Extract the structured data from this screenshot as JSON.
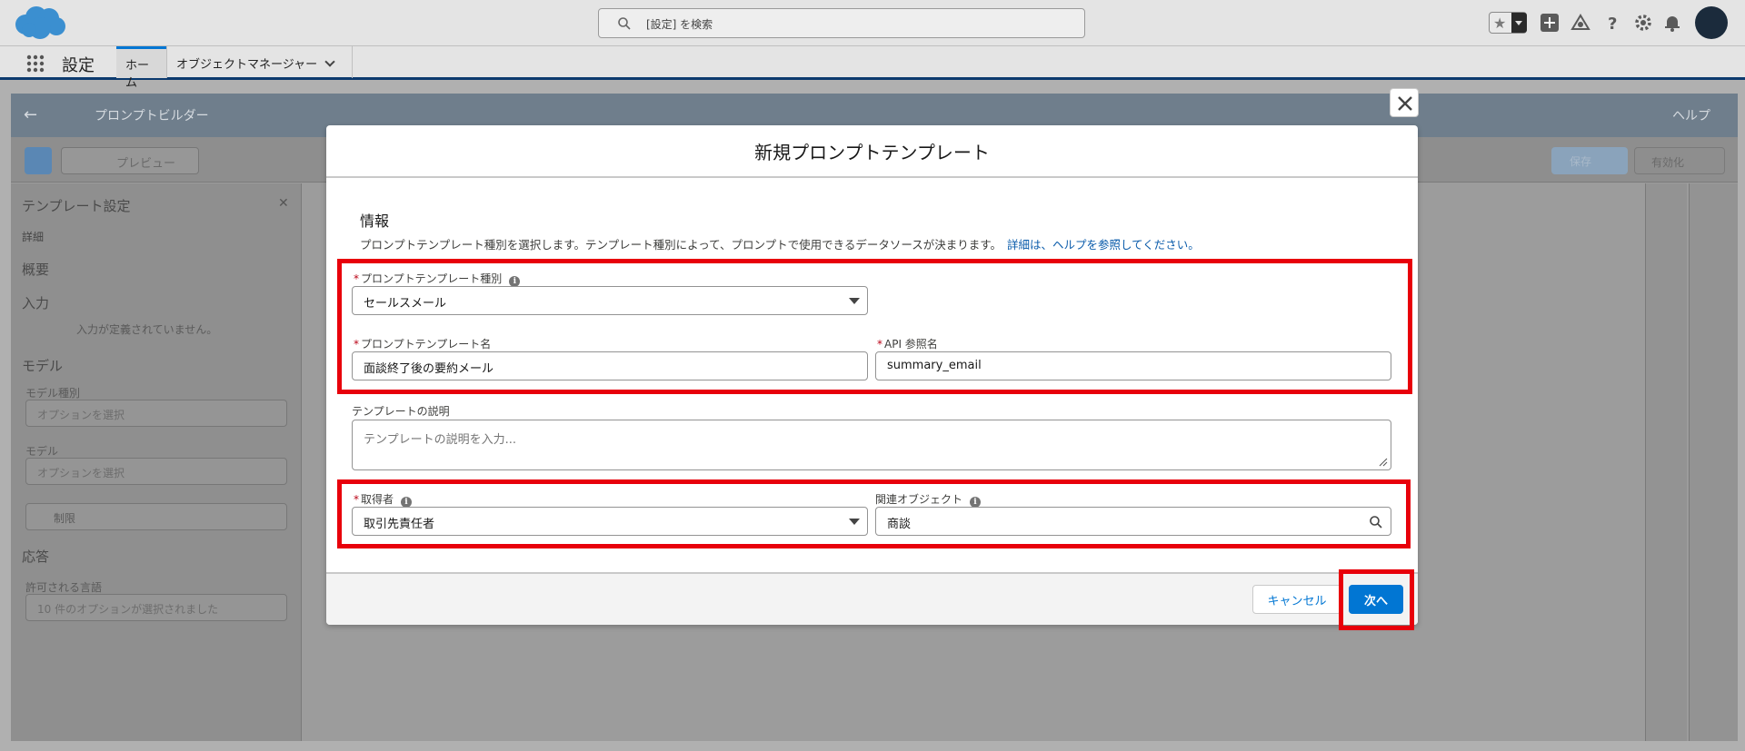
{
  "search": {
    "placeholder": "[設定] を検索"
  },
  "app": {
    "name": "設定"
  },
  "nav_tabs": [
    {
      "label": "ホーム"
    },
    {
      "label": "オブジェクトマネージャー"
    }
  ],
  "builder": {
    "title": "プロンプトビルダー",
    "help": "ヘルプ",
    "preview": "プレビュー",
    "save": "保存",
    "activate": "有効化",
    "left_panel": {
      "title": "テンプレート設定",
      "tab": "詳細",
      "sections": [
        "概要",
        "入力",
        "モデル",
        "応答"
      ],
      "no_inputs": "入力が定義されていません。",
      "model_type_label": "モデル種別",
      "model_label": "モデル",
      "select_placeholder": "オプションを選択",
      "limits": "制限",
      "allowed_languages_label": "許可される言語",
      "languages_value": "10 件のオプションが選択されました"
    }
  },
  "modal": {
    "title": "新規プロンプトテンプレート",
    "section_title": "情報",
    "description": "プロンプトテンプレート種別を選択します。テンプレート種別によって、プロンプトで使用できるデータソースが決まります。",
    "help_link": "詳細は、ヘルプを参照してください。",
    "fields": {
      "template_type": {
        "label": "プロンプトテンプレート種別",
        "value": "セールスメール"
      },
      "template_name": {
        "label": "プロンプトテンプレート名",
        "value": "面談終了後の要約メール"
      },
      "api_name": {
        "label": "API 参照名",
        "value": "summary_email"
      },
      "description": {
        "label": "テンプレートの説明",
        "placeholder": "テンプレートの説明を入力..."
      },
      "recipient": {
        "label": "取得者",
        "value": "取引先責任者"
      },
      "related_object": {
        "label": "関連オブジェクト",
        "value": "商談"
      }
    },
    "buttons": {
      "cancel": "キャンセル",
      "next": "次へ"
    }
  },
  "colors": {
    "accent": "#0176d3",
    "highlight": "#e8000b",
    "required": "#ba0517"
  }
}
